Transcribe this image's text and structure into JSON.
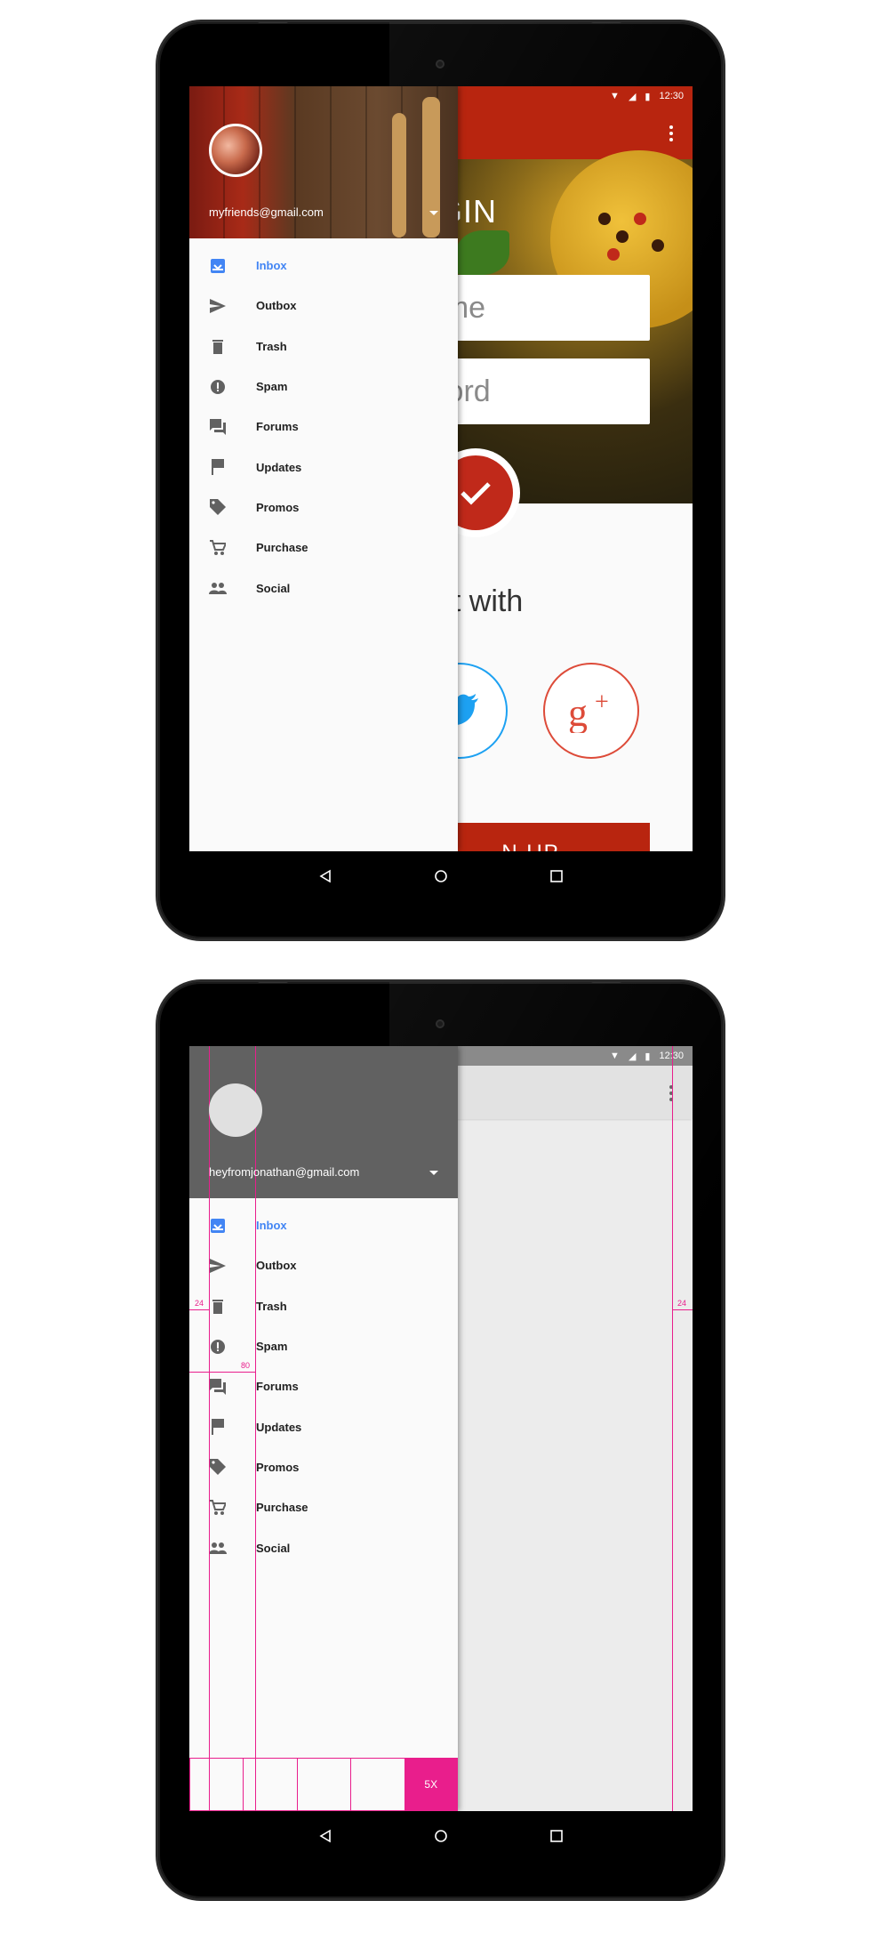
{
  "status_bar": {
    "time": "12:30"
  },
  "drawer_items": [
    {
      "label": "Inbox",
      "icon": "inbox-icon"
    },
    {
      "label": "Outbox",
      "icon": "send-icon"
    },
    {
      "label": "Trash",
      "icon": "trash-icon"
    },
    {
      "label": "Spam",
      "icon": "report-icon"
    },
    {
      "label": "Forums",
      "icon": "forum-icon"
    },
    {
      "label": "Updates",
      "icon": "flag-icon"
    },
    {
      "label": "Promos",
      "icon": "tag-icon"
    },
    {
      "label": "Purchase",
      "icon": "cart-icon"
    },
    {
      "label": "Social",
      "icon": "people-icon"
    }
  ],
  "screen1": {
    "account_email": "myfriends@gmail.com",
    "login_title": "OGIN",
    "username_placeholder": "name",
    "password_placeholder": "sword",
    "connect_text": "ect with",
    "signup_label": "N UP"
  },
  "screen2": {
    "account_email": "heyfromjonathan@gmail.com",
    "keyline_left": "24",
    "keyline_text": "80",
    "keyline_right": "24",
    "grid_label": "5X"
  },
  "colors": {
    "accent": "#4285f4",
    "brand_red": "#b8250f",
    "keyline": "#e91e8c",
    "twitter": "#1da1f2",
    "gplus": "#dd4b39"
  }
}
